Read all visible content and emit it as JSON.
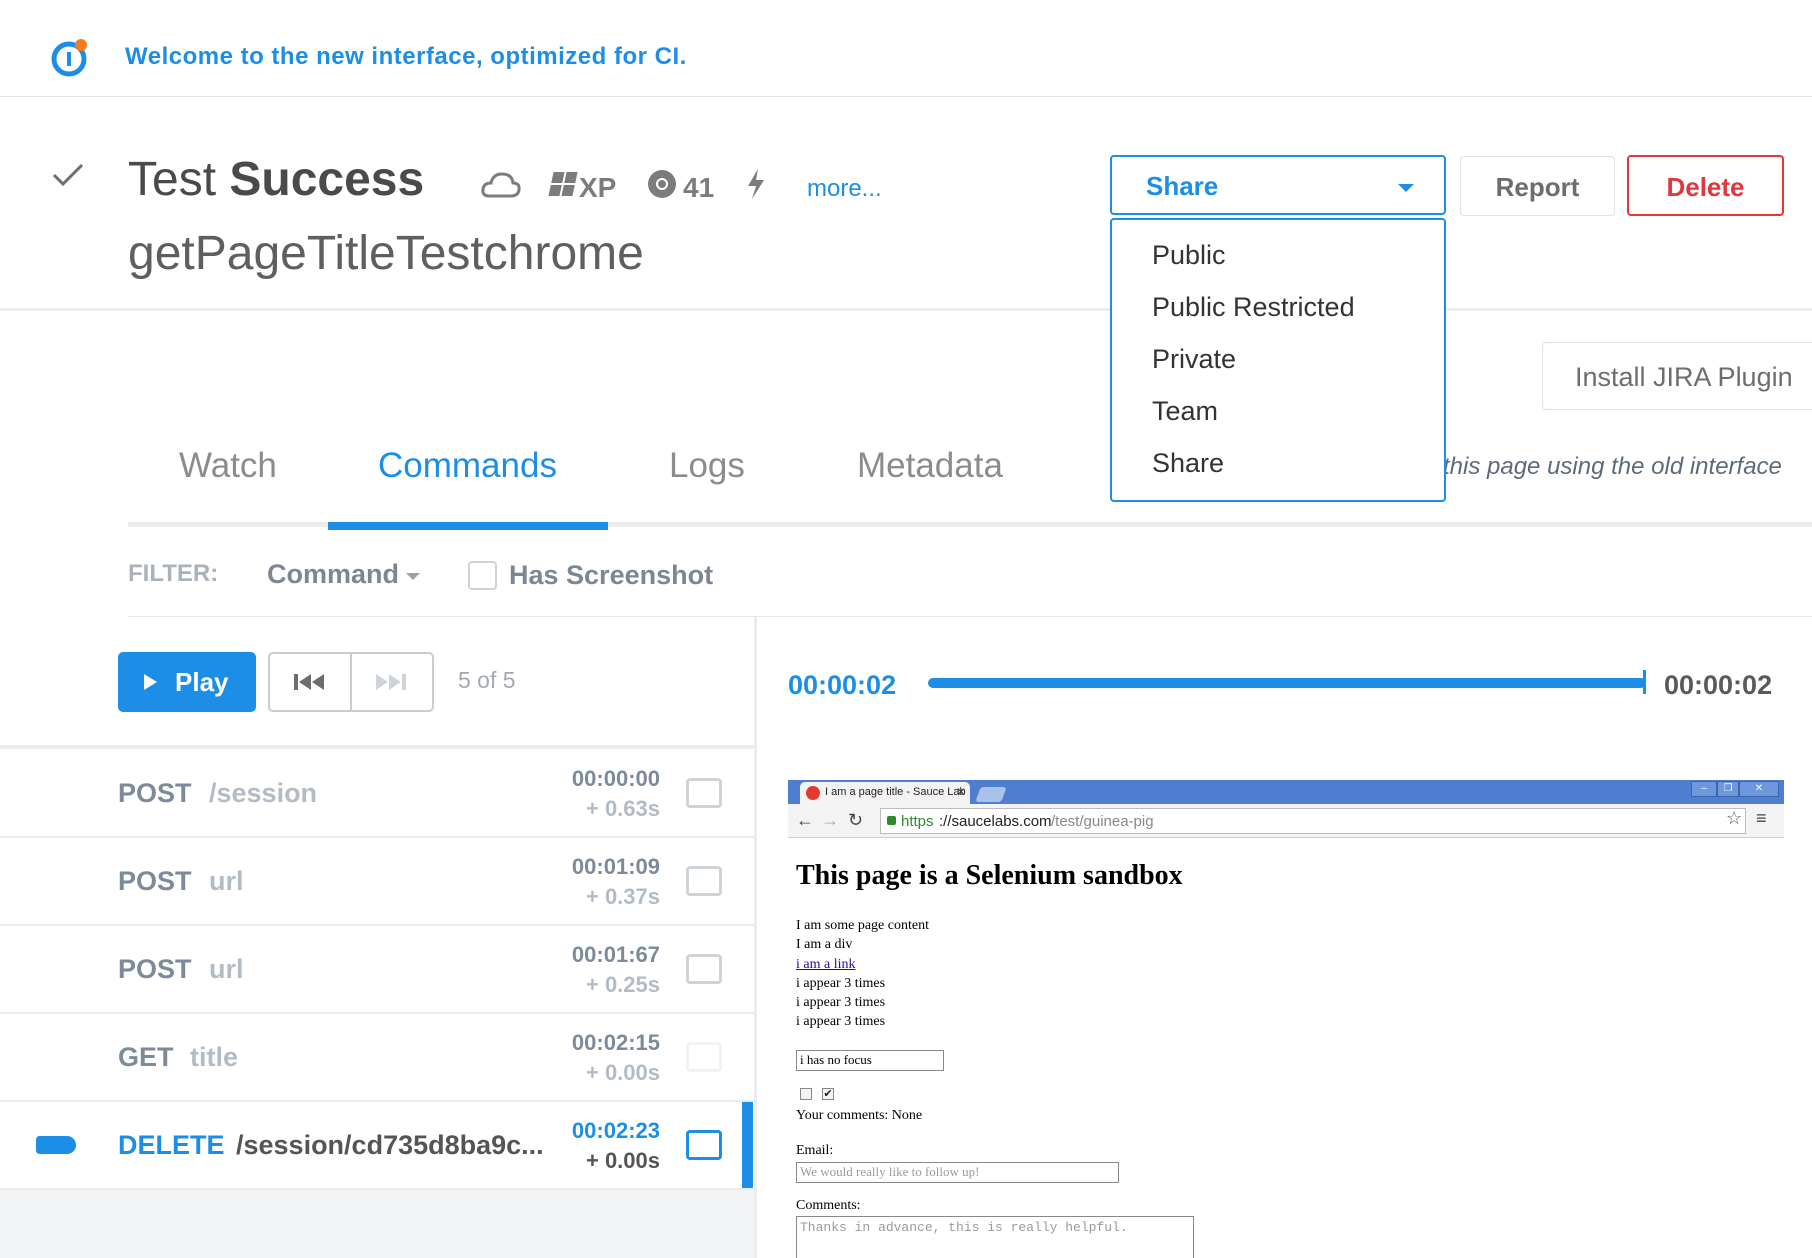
{
  "banner": {
    "text": "Welcome to the new interface, optimized for CI."
  },
  "header": {
    "title_prefix": "Test",
    "title_status": "Success",
    "subtitle": "getPageTitleTestchrome",
    "os_label": "XP",
    "browser_version": "41",
    "more_link": "more...",
    "icons": [
      "checkmark-icon",
      "cloud-icon",
      "windows-icon",
      "chrome-icon",
      "lightning-icon"
    ]
  },
  "actions": {
    "share_label": "Share",
    "report_label": "Report",
    "delete_label": "Delete",
    "jira_label": "Install JIRA Plugin"
  },
  "share_menu": {
    "items": [
      "Public",
      "Public Restricted",
      "Private",
      "Team",
      "Share"
    ]
  },
  "tabs": {
    "items": [
      "Watch",
      "Commands",
      "Logs",
      "Metadata"
    ],
    "active": "Commands",
    "old_interface_text": "this page using the old interface"
  },
  "filter": {
    "label": "FILTER:",
    "command_label": "Command",
    "has_screenshot_label": "Has Screenshot",
    "has_screenshot_checked": false
  },
  "player": {
    "play_label": "Play",
    "counter": "5 of 5",
    "time_current": "00:00:02",
    "time_total": "00:00:02",
    "progress_percent": 100
  },
  "commands": [
    {
      "method": "POST",
      "path": "/session",
      "time": "00:00:00",
      "delta": "+ 0.63s",
      "active": false
    },
    {
      "method": "POST",
      "path": "url",
      "time": "00:01:09",
      "delta": "+ 0.37s",
      "active": false
    },
    {
      "method": "POST",
      "path": "url",
      "time": "00:01:67",
      "delta": "+ 0.25s",
      "active": false
    },
    {
      "method": "GET",
      "path": "title",
      "time": "00:02:15",
      "delta": "+ 0.00s",
      "active": false
    },
    {
      "method": "DELETE",
      "path": "/session/cd735d8ba9c...",
      "time": "00:02:23",
      "delta": "+ 0.00s",
      "active": true
    }
  ],
  "screenshot": {
    "tab_title": "I am a page title - Sauce Lab",
    "url_scheme": "https",
    "url_host": "://saucelabs.com",
    "url_path": "/test/guinea-pig",
    "heading": "This page is a Selenium sandbox",
    "lines": [
      "I am some page content",
      "I am a div"
    ],
    "link_text": "i am a link",
    "repeat_lines": [
      "i appear 3 times",
      "i appear 3 times",
      "i appear 3 times"
    ],
    "focus_input_value": "i has no focus",
    "comments_result": "Your comments: None",
    "email_label": "Email:",
    "email_placeholder": "We would really like to follow up!",
    "comments_label": "Comments:",
    "comments_placeholder": "Thanks in advance, this is really helpful."
  },
  "colors": {
    "accent": "#1c8ee6",
    "danger": "#e1383e",
    "muted": "#7c8a99"
  }
}
